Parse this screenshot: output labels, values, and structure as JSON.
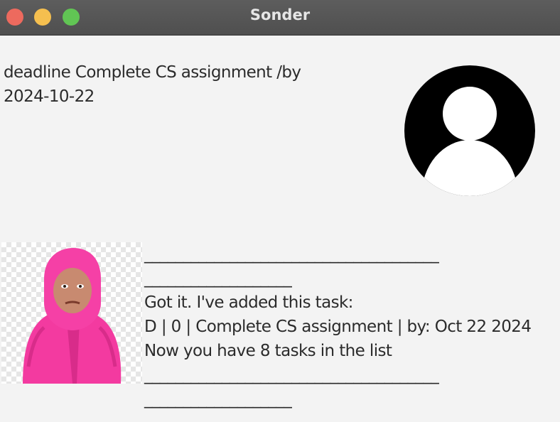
{
  "window": {
    "title": "Sonder"
  },
  "icons": {
    "close": "close-window-icon",
    "minimize": "minimize-window-icon",
    "zoom": "zoom-window-icon",
    "user_avatar": "user-avatar-icon",
    "bot_avatar": "bot-avatar-photo"
  },
  "colors": {
    "close": "#ed6a5e",
    "minimize": "#f5bf4f",
    "zoom": "#61c554",
    "background": "#f3f3f3"
  },
  "dialog": {
    "user_message": {
      "lines": [
        "deadline Complete CS assignment /by",
        "2024-10-22"
      ]
    },
    "bot_message": {
      "lines": [
        "______________________________________",
        "___________________",
        "Got it. I've added this task:",
        "D | 0 | Complete CS assignment | by: Oct 22 2024",
        "Now you have 8 tasks in the list",
        "______________________________________",
        "___________________"
      ]
    }
  }
}
